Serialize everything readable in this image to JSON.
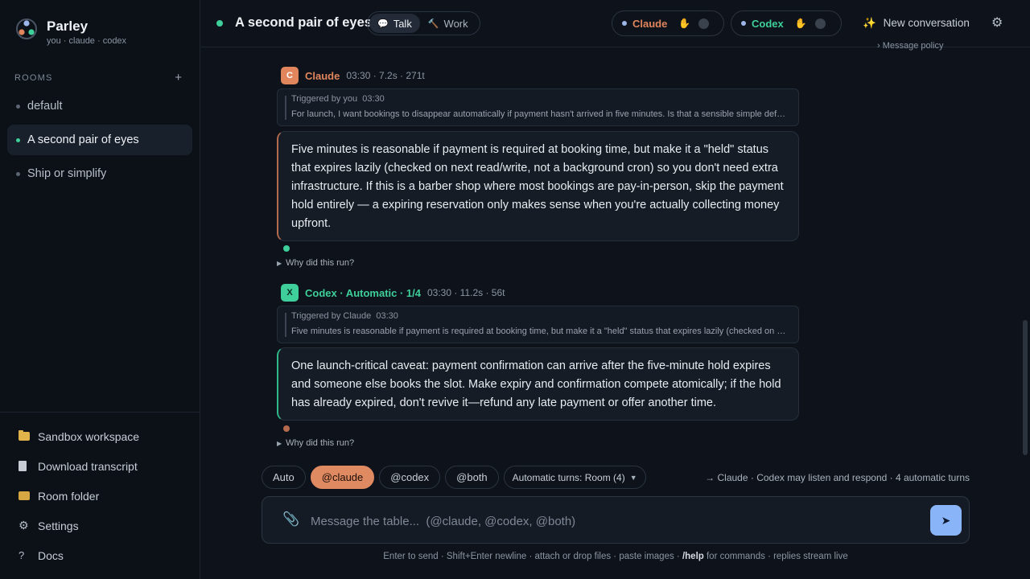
{
  "app": {
    "title": "Parley",
    "subtitle": "you · claude · codex"
  },
  "sidebar": {
    "rooms_label": "ROOMS",
    "add_icon": "plus-icon",
    "rooms": [
      {
        "label": "default",
        "active": false
      },
      {
        "label": "A second pair of eyes",
        "active": true
      },
      {
        "label": "Ship or simplify",
        "active": false
      }
    ],
    "links": [
      {
        "label": "Sandbox workspace",
        "icon": "folder-icon"
      },
      {
        "label": "Download transcript",
        "icon": "document-icon"
      },
      {
        "label": "Room folder",
        "icon": "folder-icon"
      },
      {
        "label": "Settings",
        "icon": "gear-icon"
      },
      {
        "label": "Docs",
        "icon": "question-icon"
      }
    ]
  },
  "header": {
    "title": "A second pair of eyes",
    "modes": [
      {
        "label": "Talk",
        "icon": "speech-bubble-icon",
        "active": true
      },
      {
        "label": "Work",
        "icon": "hammer-icon",
        "active": false
      }
    ],
    "agents": [
      {
        "name": "Claude",
        "color": "#e0855c",
        "dot": "#9db5e8"
      },
      {
        "name": "Codex",
        "color": "#3ecf9a",
        "dot": "#9db5e8"
      }
    ],
    "new_conversation": "New conversation",
    "settings_icon": "gear-icon"
  },
  "colors": {
    "claude": "#e0855c",
    "codex": "#3ecf9a",
    "accent": "#8ab4f8",
    "chip_active": "#e08a62"
  },
  "messages": [
    {
      "avatar": "C",
      "name": "Claude",
      "meta": "03:30 · 7.2s · 271t",
      "trigger_label": "Triggered by you",
      "trigger_time": "03:30",
      "trigger_text": "For launch, I want bookings to disappear automatically if payment hasn't arrived in five minutes. Is that a sensible simple default?",
      "body": "Five minutes is reasonable if payment is required at booking time, but make it a \"held\" status that expires lazily (checked on next read/write, not a background cron) so you don't need extra infrastructure. If this is a barber shop where most bookings are pay-in-person, skip the payment hold entirely — a expiring reservation only makes sense when you're actually collecting money upfront.",
      "why": "Why did this run?"
    },
    {
      "avatar": "X",
      "name": "Codex · Automatic · 1/4",
      "meta": "03:30 · 11.2s · 56t",
      "trigger_label": "Triggered by Claude",
      "trigger_time": "03:30",
      "trigger_text": "Five minutes is reasonable if payment is required at booking time, but make it a \"held\" status that expires lazily (checked on next read/write)",
      "body": "One launch-critical caveat: payment confirmation can arrive after the five-minute hold expires and someone else books the slot. Make expiry and confirmation compete atomically; if the hold has already expired, don't revive it—refund any late payment or offer another time.",
      "why": "Why did this run?"
    }
  ],
  "policy_link": "Message policy",
  "composer": {
    "chips": [
      {
        "label": "Auto",
        "active": false
      },
      {
        "label": "@claude",
        "active": true
      },
      {
        "label": "@codex",
        "active": false
      },
      {
        "label": "@both",
        "active": false
      }
    ],
    "turns_select": "Automatic turns: Room (4)",
    "route_hint": "→ Claude · Codex may listen and respond · 4 automatic turns",
    "placeholder": "Message the table...  (@claude, @codex, @both)",
    "value": "",
    "footer_before": "Enter to send · Shift+Enter newline · attach or drop files · paste images · ",
    "footer_cmd": "/help",
    "footer_after": " for commands · replies stream live"
  }
}
